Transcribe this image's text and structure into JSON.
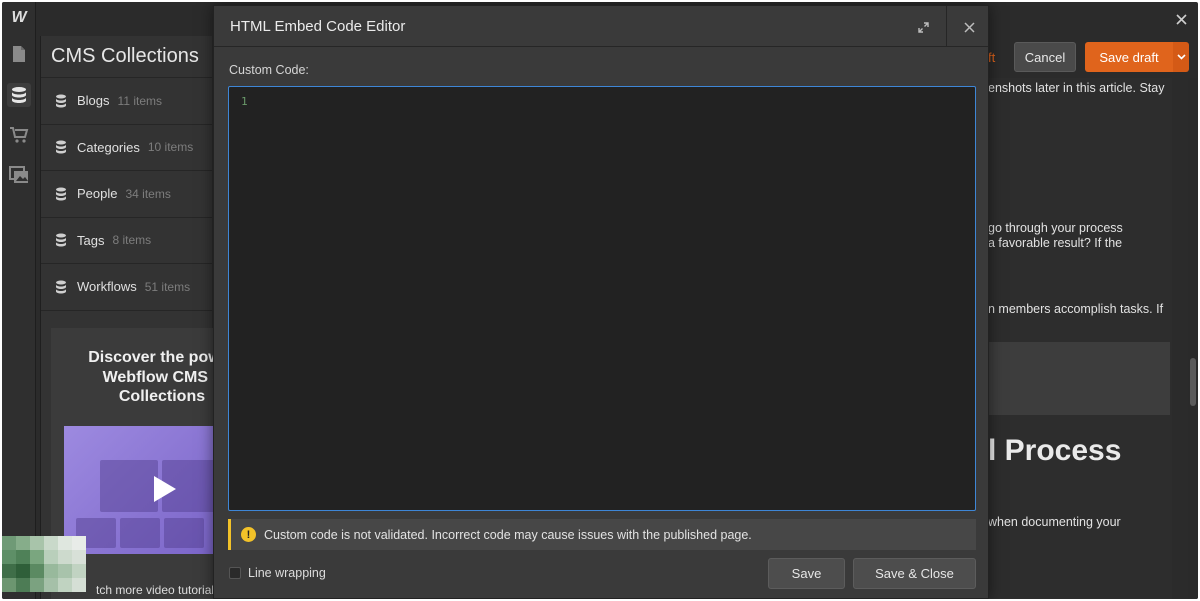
{
  "app": {
    "logo": "W"
  },
  "rail": {
    "icons": [
      "pages-icon",
      "cms-database-icon",
      "ecommerce-cart-icon",
      "assets-images-icon"
    ]
  },
  "cms": {
    "title": "CMS Collections",
    "collections": [
      {
        "name": "Blogs",
        "count": "11 items"
      },
      {
        "name": "Categories",
        "count": "10 items"
      },
      {
        "name": "People",
        "count": "34 items"
      },
      {
        "name": "Tags",
        "count": "8 items"
      },
      {
        "name": "Workflows",
        "count": "51 items"
      }
    ],
    "promo": {
      "title_line1": "Discover the power",
      "title_line2": "Webflow CMS a",
      "title_line3": "Collections",
      "footer": "tch more video tutorials"
    }
  },
  "toolbar": {
    "draft_fragment": "ft",
    "cancel_label": "Cancel",
    "save_draft_label": "Save draft"
  },
  "article": {
    "lines": [
      "enshots later in this article. Stay",
      "go through your process",
      "a favorable result? If the",
      "n members accomplish tasks. If",
      "when documenting your"
    ],
    "heading": "l Process"
  },
  "modal": {
    "title": "HTML Embed Code Editor",
    "custom_code_label": "Custom Code:",
    "line_number": "1",
    "code_value": "",
    "warning": "Custom code is not validated. Incorrect code may cause issues with the published page.",
    "line_wrapping_label": "Line wrapping",
    "line_wrapping_checked": false,
    "save_label": "Save",
    "save_close_label": "Save & Close"
  },
  "colors": {
    "accent_orange": "#e0641c",
    "warning_yellow": "#f2c229",
    "editor_focus_blue": "#3e86d6",
    "promo_purple": "#8c78d8"
  }
}
